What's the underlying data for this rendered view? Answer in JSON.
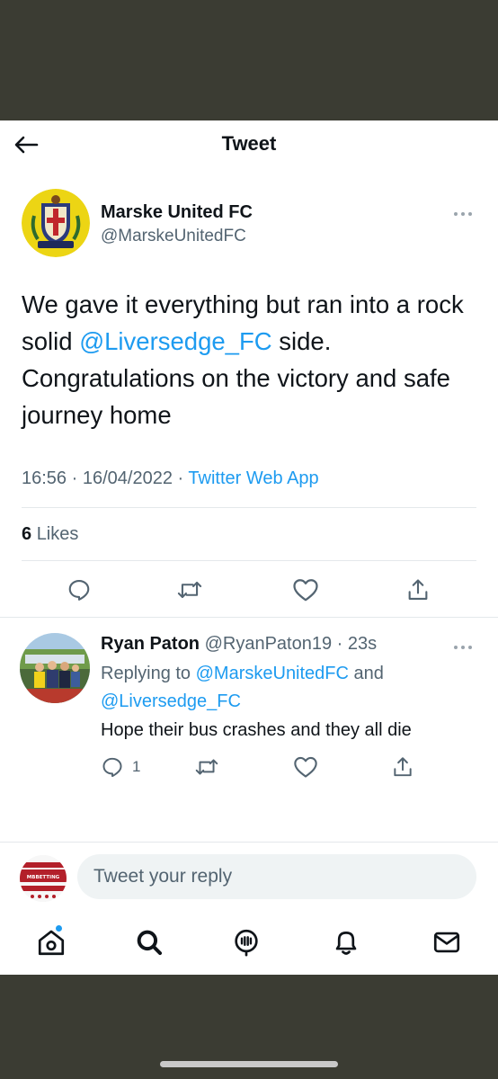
{
  "header": {
    "title": "Tweet"
  },
  "tweet": {
    "author_name": "Marske United FC",
    "author_handle": "@MarskeUnitedFC",
    "text_1": "We gave it everything but ran into a rock solid ",
    "mention": "@Liversedge_FC",
    "text_2": " side. Congratulations on the victory and safe journey home",
    "time": "16:56",
    "date": "16/04/2022",
    "separator": "·",
    "source": "Twitter Web App",
    "likes_count": "6",
    "likes_label": "Likes"
  },
  "reply": {
    "name": "Ryan Paton",
    "handle": "@RyanPaton19",
    "age": "23s",
    "replying_prefix": "Replying to ",
    "mention_1": "@MarskeUnitedFC",
    "and_word": " and",
    "mention_2": "@Liversedge_FC",
    "text": "Hope their bus crashes and they all die",
    "reply_count": "1"
  },
  "composer": {
    "placeholder": "Tweet your reply",
    "avatar_text": "MBBETTING"
  },
  "colors": {
    "accent": "#1d9bf0",
    "secondary_text": "#536471",
    "background_band": "#3b3c33"
  },
  "icons": {
    "header": [
      "back-arrow-icon"
    ],
    "actions": [
      "reply-icon",
      "retweet-icon",
      "like-icon",
      "share-icon"
    ],
    "tabs": [
      "home-icon",
      "search-icon",
      "spaces-icon",
      "notifications-icon",
      "messages-icon"
    ]
  }
}
